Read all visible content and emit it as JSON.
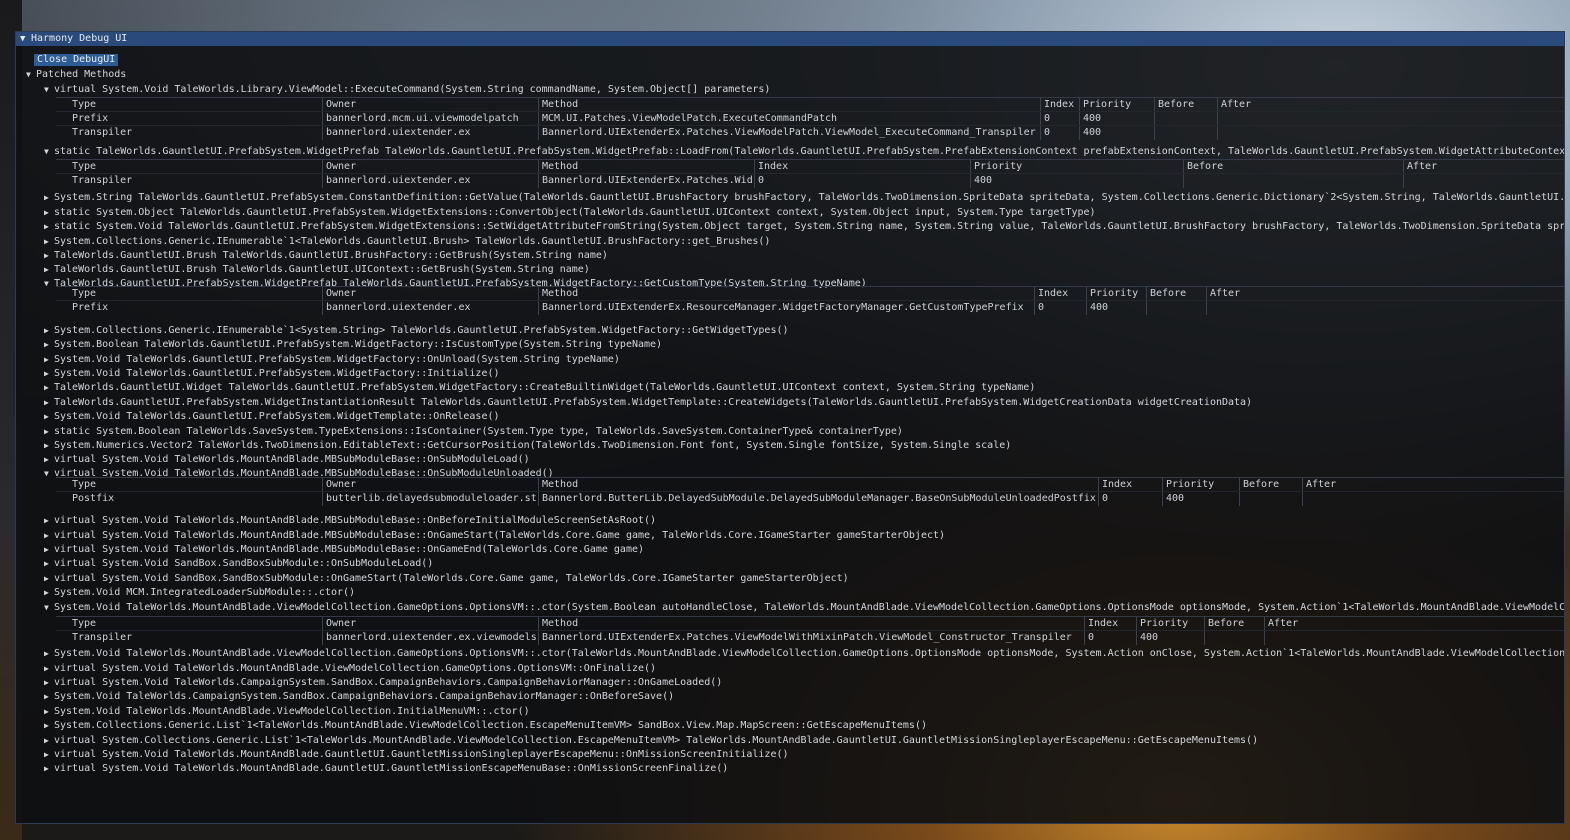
{
  "window": {
    "title": "Harmony Debug UI",
    "close_label": "Close DebugUI"
  },
  "root_header": "Patched Methods",
  "table_headers": {
    "type": "Type",
    "owner": "Owner",
    "method": "Method",
    "index": "Index",
    "priority": "Priority",
    "before": "Before",
    "after": "After"
  },
  "lines": [
    {
      "id": "l0",
      "open": true,
      "text": "virtual System.Void TaleWorlds.Library.ViewModel::ExecuteCommand(System.String commandName, System.Object[] parameters)"
    },
    {
      "id": "l1",
      "open": true,
      "text": "static TaleWorlds.GauntletUI.PrefabSystem.WidgetPrefab TaleWorlds.GauntletUI.PrefabSystem.WidgetPrefab::LoadFrom(TaleWorlds.GauntletUI.PrefabSystem.PrefabExtensionContext prefabExtensionContext, TaleWorlds.GauntletUI.PrefabSystem.WidgetAttributeContext w"
    },
    {
      "id": "l2",
      "open": false,
      "text": "System.String TaleWorlds.GauntletUI.PrefabSystem.ConstantDefinition::GetValue(TaleWorlds.GauntletUI.BrushFactory brushFactory, TaleWorlds.TwoDimension.SpriteData spriteData, System.Collections.Generic.Dictionary`2<System.String, TaleWorlds.GauntletUI.Pre"
    },
    {
      "id": "l3",
      "open": false,
      "text": "static System.Object TaleWorlds.GauntletUI.PrefabSystem.WidgetExtensions::ConvertObject(TaleWorlds.GauntletUI.UIContext context, System.Object input, System.Type targetType)"
    },
    {
      "id": "l4",
      "open": false,
      "text": "static System.Void TaleWorlds.GauntletUI.PrefabSystem.WidgetExtensions::SetWidgetAttributeFromString(System.Object target, System.String name, System.String value, TaleWorlds.GauntletUI.BrushFactory brushFactory, TaleWorlds.TwoDimension.SpriteData sprite"
    },
    {
      "id": "l5",
      "open": false,
      "text": "System.Collections.Generic.IEnumerable`1<TaleWorlds.GauntletUI.Brush> TaleWorlds.GauntletUI.BrushFactory::get_Brushes()"
    },
    {
      "id": "l6",
      "open": false,
      "text": "TaleWorlds.GauntletUI.Brush TaleWorlds.GauntletUI.BrushFactory::GetBrush(System.String name)"
    },
    {
      "id": "l7",
      "open": false,
      "text": "TaleWorlds.GauntletUI.Brush TaleWorlds.GauntletUI.UIContext::GetBrush(System.String name)"
    },
    {
      "id": "l8",
      "open": true,
      "text": "TaleWorlds.GauntletUI.PrefabSystem.WidgetPrefab TaleWorlds.GauntletUI.PrefabSystem.WidgetFactory::GetCustomType(System.String typeName)"
    },
    {
      "id": "l9",
      "open": false,
      "text": "System.Collections.Generic.IEnumerable`1<System.String> TaleWorlds.GauntletUI.PrefabSystem.WidgetFactory::GetWidgetTypes()"
    },
    {
      "id": "l10",
      "open": false,
      "text": "System.Boolean TaleWorlds.GauntletUI.PrefabSystem.WidgetFactory::IsCustomType(System.String typeName)"
    },
    {
      "id": "l11",
      "open": false,
      "text": "System.Void TaleWorlds.GauntletUI.PrefabSystem.WidgetFactory::OnUnload(System.String typeName)"
    },
    {
      "id": "l12",
      "open": false,
      "text": "System.Void TaleWorlds.GauntletUI.PrefabSystem.WidgetFactory::Initialize()"
    },
    {
      "id": "l13",
      "open": false,
      "text": "TaleWorlds.GauntletUI.Widget TaleWorlds.GauntletUI.PrefabSystem.WidgetFactory::CreateBuiltinWidget(TaleWorlds.GauntletUI.UIContext context, System.String typeName)"
    },
    {
      "id": "l14",
      "open": false,
      "text": "TaleWorlds.GauntletUI.PrefabSystem.WidgetInstantiationResult TaleWorlds.GauntletUI.PrefabSystem.WidgetTemplate::CreateWidgets(TaleWorlds.GauntletUI.PrefabSystem.WidgetCreationData widgetCreationData)"
    },
    {
      "id": "l15",
      "open": false,
      "text": "System.Void TaleWorlds.GauntletUI.PrefabSystem.WidgetTemplate::OnRelease()"
    },
    {
      "id": "l16",
      "open": false,
      "text": "static System.Boolean TaleWorlds.SaveSystem.TypeExtensions::IsContainer(System.Type type, TaleWorlds.SaveSystem.ContainerType& containerType)"
    },
    {
      "id": "l17",
      "open": false,
      "text": "System.Numerics.Vector2 TaleWorlds.TwoDimension.EditableText::GetCursorPosition(TaleWorlds.TwoDimension.Font font, System.Single fontSize, System.Single scale)"
    },
    {
      "id": "l18",
      "open": false,
      "text": "virtual System.Void TaleWorlds.MountAndBlade.MBSubModuleBase::OnSubModuleLoad()"
    },
    {
      "id": "l19",
      "open": true,
      "text": "virtual System.Void TaleWorlds.MountAndBlade.MBSubModuleBase::OnSubModuleUnloaded()"
    },
    {
      "id": "l20",
      "open": false,
      "text": "virtual System.Void TaleWorlds.MountAndBlade.MBSubModuleBase::OnBeforeInitialModuleScreenSetAsRoot()"
    },
    {
      "id": "l21",
      "open": false,
      "text": "virtual System.Void TaleWorlds.MountAndBlade.MBSubModuleBase::OnGameStart(TaleWorlds.Core.Game game, TaleWorlds.Core.IGameStarter gameStarterObject)"
    },
    {
      "id": "l22",
      "open": false,
      "text": "virtual System.Void TaleWorlds.MountAndBlade.MBSubModuleBase::OnGameEnd(TaleWorlds.Core.Game game)"
    },
    {
      "id": "l23",
      "open": false,
      "text": "virtual System.Void SandBox.SandBoxSubModule::OnSubModuleLoad()"
    },
    {
      "id": "l24",
      "open": false,
      "text": "virtual System.Void SandBox.SandBoxSubModule::OnGameStart(TaleWorlds.Core.Game game, TaleWorlds.Core.IGameStarter gameStarterObject)"
    },
    {
      "id": "l25",
      "open": false,
      "text": "System.Void MCM.IntegratedLoaderSubModule::.ctor()"
    },
    {
      "id": "l26",
      "open": true,
      "text": "System.Void TaleWorlds.MountAndBlade.ViewModelCollection.GameOptions.OptionsVM::.ctor(System.Boolean autoHandleClose, TaleWorlds.MountAndBlade.ViewModelCollection.GameOptions.OptionsMode optionsMode, System.Action`1<TaleWorlds.MountAndBlade.ViewModelColl"
    },
    {
      "id": "l27",
      "open": false,
      "text": "System.Void TaleWorlds.MountAndBlade.ViewModelCollection.GameOptions.OptionsVM::.ctor(TaleWorlds.MountAndBlade.ViewModelCollection.GameOptions.OptionsMode optionsMode, System.Action onClose, System.Action`1<TaleWorlds.MountAndBlade.ViewModelCollection.Ga"
    },
    {
      "id": "l28",
      "open": false,
      "text": "virtual System.Void TaleWorlds.MountAndBlade.ViewModelCollection.GameOptions.OptionsVM::OnFinalize()"
    },
    {
      "id": "l29",
      "open": false,
      "text": "virtual System.Void TaleWorlds.CampaignSystem.SandBox.CampaignBehaviors.CampaignBehaviorManager::OnGameLoaded()"
    },
    {
      "id": "l30",
      "open": false,
      "text": "System.Void TaleWorlds.CampaignSystem.SandBox.CampaignBehaviors.CampaignBehaviorManager::OnBeforeSave()"
    },
    {
      "id": "l31",
      "open": false,
      "text": "System.Void TaleWorlds.MountAndBlade.ViewModelCollection.InitialMenuVM::.ctor()"
    },
    {
      "id": "l32",
      "open": false,
      "text": "System.Collections.Generic.List`1<TaleWorlds.MountAndBlade.ViewModelCollection.EscapeMenuItemVM> SandBox.View.Map.MapScreen::GetEscapeMenuItems()"
    },
    {
      "id": "l33",
      "open": false,
      "text": "virtual System.Collections.Generic.List`1<TaleWorlds.MountAndBlade.ViewModelCollection.EscapeMenuItemVM> TaleWorlds.MountAndBlade.GauntletUI.GauntletMissionSingleplayerEscapeMenu::GetEscapeMenuItems()"
    },
    {
      "id": "l34",
      "open": false,
      "text": "virtual System.Void TaleWorlds.MountAndBlade.GauntletUI.GauntletMissionSingleplayerEscapeMenu::OnMissionScreenInitialize()"
    },
    {
      "id": "l35",
      "open": false,
      "text": "virtual System.Void TaleWorlds.MountAndBlade.GauntletUI.GauntletMissionEscapeMenuBase::OnMissionScreenFinalize()"
    }
  ],
  "tables": {
    "t0": [
      {
        "type": "Prefix",
        "owner": "bannerlord.mcm.ui.viewmodelpatch",
        "method": "MCM.UI.Patches.ViewModelPatch.ExecuteCommandPatch",
        "index": "0",
        "priority": "400",
        "before": "",
        "after": ""
      },
      {
        "type": "Transpiler",
        "owner": "bannerlord.uiextender.ex",
        "method": "Bannerlord.UIExtenderEx.Patches.ViewModelPatch.ViewModel_ExecuteCommand_Transpiler",
        "index": "0",
        "priority": "400",
        "before": "",
        "after": ""
      }
    ],
    "t1": [
      {
        "type": "Transpiler",
        "owner": "bannerlord.uiextender.ex",
        "method": "Bannerlord.UIExtenderEx.Patches.Wid",
        "index": "0",
        "priority": "400",
        "before": "",
        "after": ""
      }
    ],
    "t2": [
      {
        "type": "Prefix",
        "owner": "bannerlord.uiextender.ex",
        "method": "Bannerlord.UIExtenderEx.ResourceManager.WidgetFactoryManager.GetCustomTypePrefix",
        "index": "0",
        "priority": "400",
        "before": "",
        "after": ""
      }
    ],
    "t3": [
      {
        "type": "Postfix",
        "owner": "butterlib.delayedsubmoduleloader.st",
        "method": "Bannerlord.ButterLib.DelayedSubModule.DelayedSubModuleManager.BaseOnSubModuleUnloadedPostfix",
        "index": "0",
        "priority": "400",
        "before": "",
        "after": ""
      }
    ],
    "t4": [
      {
        "type": "Transpiler",
        "owner": "bannerlord.uiextender.ex.viewmodels",
        "method": "Bannerlord.UIExtenderEx.Patches.ViewModelWithMixinPatch.ViewModel_Constructor_Transpiler",
        "index": "0",
        "priority": "400",
        "before": "",
        "after": ""
      }
    ]
  }
}
